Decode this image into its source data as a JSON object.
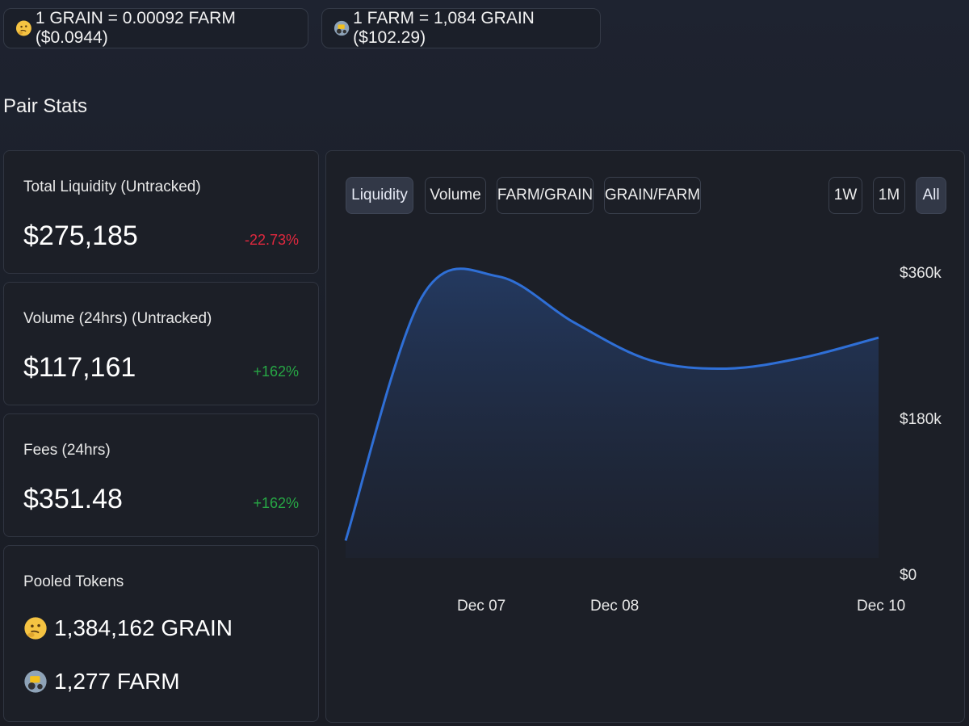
{
  "price_pills": {
    "grain": "1 GRAIN = 0.00092 FARM ($0.0944)",
    "farm": "1 FARM = 1,084 GRAIN ($102.29)"
  },
  "section_title": "Pair Stats",
  "stats": {
    "liquidity": {
      "label": "Total Liquidity (Untracked)",
      "value": "$275,185",
      "change": "-22.73%"
    },
    "volume": {
      "label": "Volume (24hrs) (Untracked)",
      "value": "$117,161",
      "change": "+162%"
    },
    "fees": {
      "label": "Fees (24hrs)",
      "value": "$351.48",
      "change": "+162%"
    }
  },
  "pooled": {
    "label": "Pooled Tokens",
    "grain": "1,384,162 GRAIN",
    "farm": "1,277 FARM"
  },
  "chart_tabs": {
    "liquidity": "Liquidity",
    "volume": "Volume",
    "farm_grain": "FARM/GRAIN",
    "grain_farm": "GRAIN/FARM",
    "w1": "1W",
    "m1": "1M",
    "all": "All"
  },
  "colors": {
    "line": "#2f6fd6",
    "negative": "#e0283e",
    "positive": "#27a745"
  },
  "icons": {
    "grain": "thinking-face-icon",
    "farm": "tractor-icon"
  },
  "chart_data": {
    "type": "area",
    "x": [
      "2020-12-06",
      "2020-12-07",
      "2020-12-07",
      "2020-12-08",
      "2020-12-08",
      "2020-12-09",
      "2020-12-09",
      "2020-12-10"
    ],
    "values": [
      40000,
      330000,
      355000,
      300000,
      255000,
      245000,
      258000,
      282000
    ],
    "xticks": [
      "Dec 07",
      "Dec 08",
      "Dec 10"
    ],
    "yticks": [
      "$0",
      "$180k",
      "$360k"
    ],
    "ylim": [
      0,
      360000
    ],
    "grid": false,
    "legend": "none"
  }
}
